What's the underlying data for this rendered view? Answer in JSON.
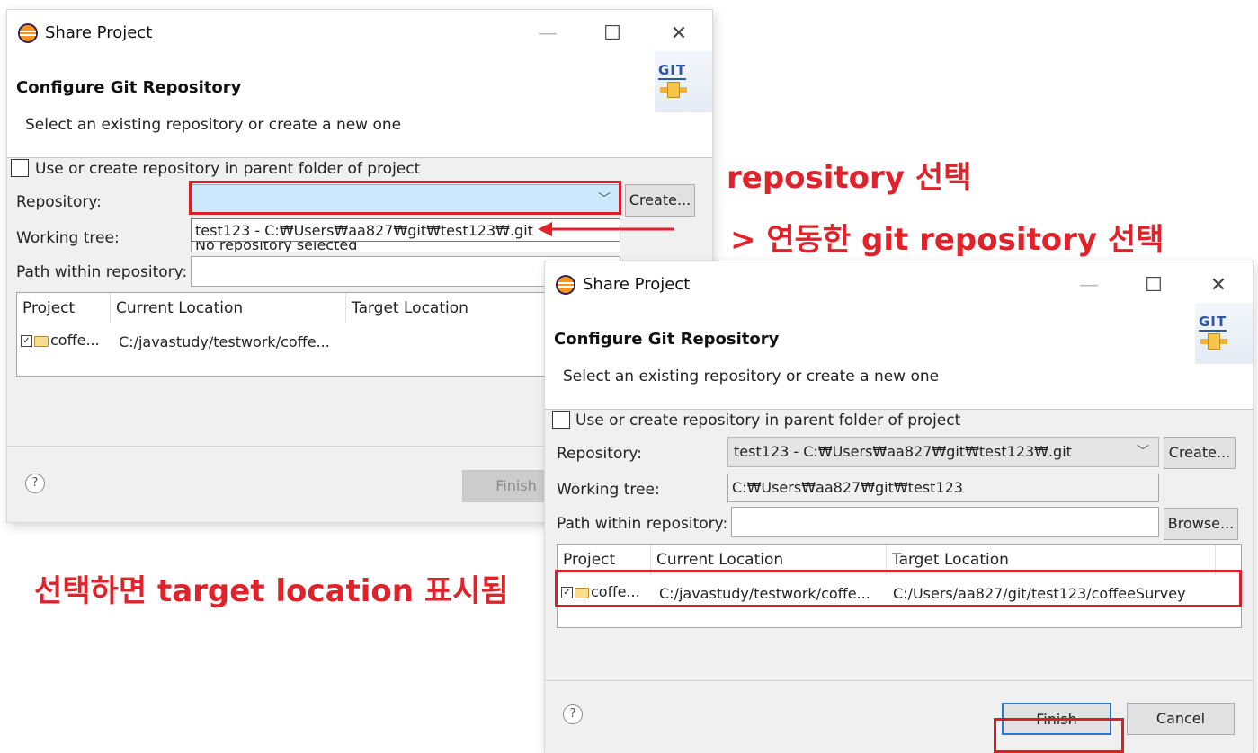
{
  "dialog1": {
    "title": "Share Project",
    "header_title": "Configure Git Repository",
    "header_desc": "Select an existing repository or create a new one",
    "logo_text": "GIT",
    "checkbox_label": "Use or create repository in parent folder of project",
    "repository_label": "Repository:",
    "create_button": "Create...",
    "working_tree_label": "Working tree:",
    "working_tree_value": "No repository selected",
    "path_label": "Path within repository:",
    "dropdown_option": "test123 - C:₩Users₩aa827₩git₩test123₩.git",
    "table": {
      "columns": [
        "Project",
        "Current Location",
        "Target Location"
      ],
      "row": {
        "project": "coffe...",
        "current": "C:/javastudy/testwork/coffe..."
      }
    },
    "finish_button": "Finish",
    "help": "?"
  },
  "dialog2": {
    "title": "Share Project",
    "header_title": "Configure Git Repository",
    "header_desc": "Select an existing repository or create a new one",
    "logo_text": "GIT",
    "checkbox_label": "Use or create repository in parent folder of project",
    "repository_label": "Repository:",
    "repository_value": "test123 - C:₩Users₩aa827₩git₩test123₩.git",
    "create_button": "Create...",
    "working_tree_label": "Working tree:",
    "working_tree_value": "C:₩Users₩aa827₩git₩test123",
    "path_label": "Path within repository:",
    "browse_button": "Browse...",
    "table": {
      "columns": [
        "Project",
        "Current Location",
        "Target Location"
      ],
      "row": {
        "project": "coffe...",
        "current": "C:/javastudy/testwork/coffe...",
        "target": "C:/Users/aa827/git/test123/coffeeSurvey"
      }
    },
    "finish_button": "Finish",
    "cancel_button": "Cancel",
    "help": "?"
  },
  "annotations": {
    "line1": "repository 선택",
    "line2": "> 연동한 git repository 선택",
    "line3": "선택하면 target location 표시됨"
  },
  "colors": {
    "annotation_red": "#e0222a",
    "dialog_bg": "#f0f0f0",
    "selection_blue": "#cce8ff"
  }
}
